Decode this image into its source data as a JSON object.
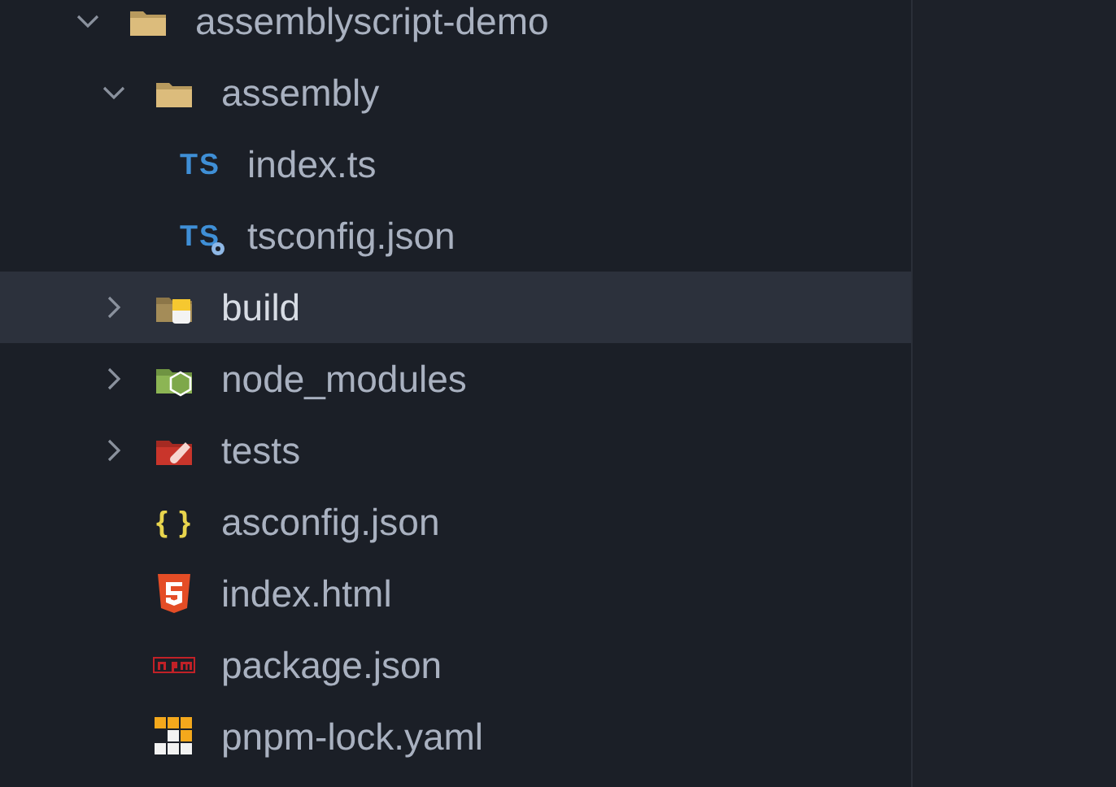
{
  "explorer": {
    "tree": [
      {
        "name": "assemblyscript-demo",
        "kind": "folder",
        "expanded": true,
        "selected": false,
        "children": [
          {
            "name": "assembly",
            "kind": "folder",
            "expanded": true,
            "selected": false,
            "children": [
              {
                "name": "index.ts",
                "kind": "typescript",
                "badge": "TS",
                "selected": false
              },
              {
                "name": "tsconfig.json",
                "kind": "tsconfig",
                "badge": "TS",
                "selected": false
              }
            ]
          },
          {
            "name": "build",
            "kind": "build-folder",
            "expanded": false,
            "selected": true
          },
          {
            "name": "node_modules",
            "kind": "node-folder",
            "expanded": false,
            "selected": false
          },
          {
            "name": "tests",
            "kind": "test-folder",
            "expanded": false,
            "selected": false
          },
          {
            "name": "asconfig.json",
            "kind": "json",
            "badge": "{ }",
            "selected": false
          },
          {
            "name": "index.html",
            "kind": "html",
            "selected": false
          },
          {
            "name": "package.json",
            "kind": "npm",
            "selected": false
          },
          {
            "name": "pnpm-lock.yaml",
            "kind": "pnpm",
            "selected": false
          }
        ]
      }
    ]
  }
}
